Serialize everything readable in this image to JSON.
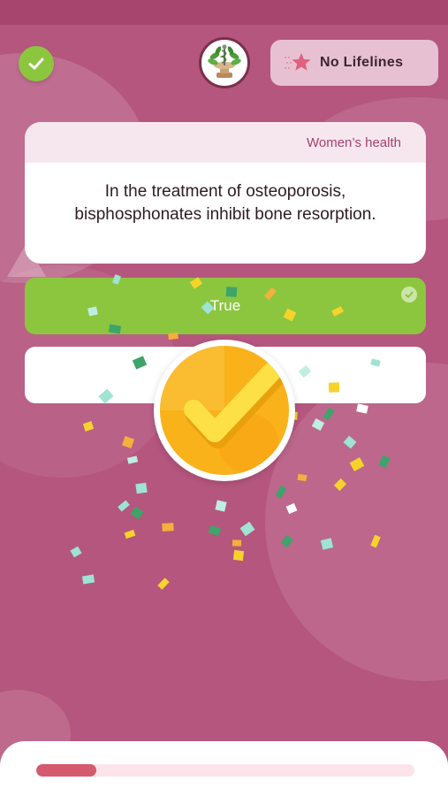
{
  "header": {
    "lifeline_label": "No Lifelines",
    "icons": [
      "check-icon",
      "medical-logo",
      "star-lifeline-icon"
    ]
  },
  "question": {
    "category": "Women’s health",
    "text": "In the treatment of osteoporosis, bisphosphonates inhibit bone resorption."
  },
  "answers": [
    {
      "label": "True",
      "state": "correct-selected"
    },
    {
      "label": "",
      "state": "unselected"
    }
  ],
  "feedback": {
    "icon": "correct-check-icon"
  },
  "progress": {
    "fraction": 0.16
  },
  "colors": {
    "background": "#b5567e",
    "correct": "#8cc63f",
    "accent": "#a3426d",
    "medal": "#f9b21a",
    "progress_fill": "#d65a6e",
    "progress_track": "#fbe4ea"
  }
}
